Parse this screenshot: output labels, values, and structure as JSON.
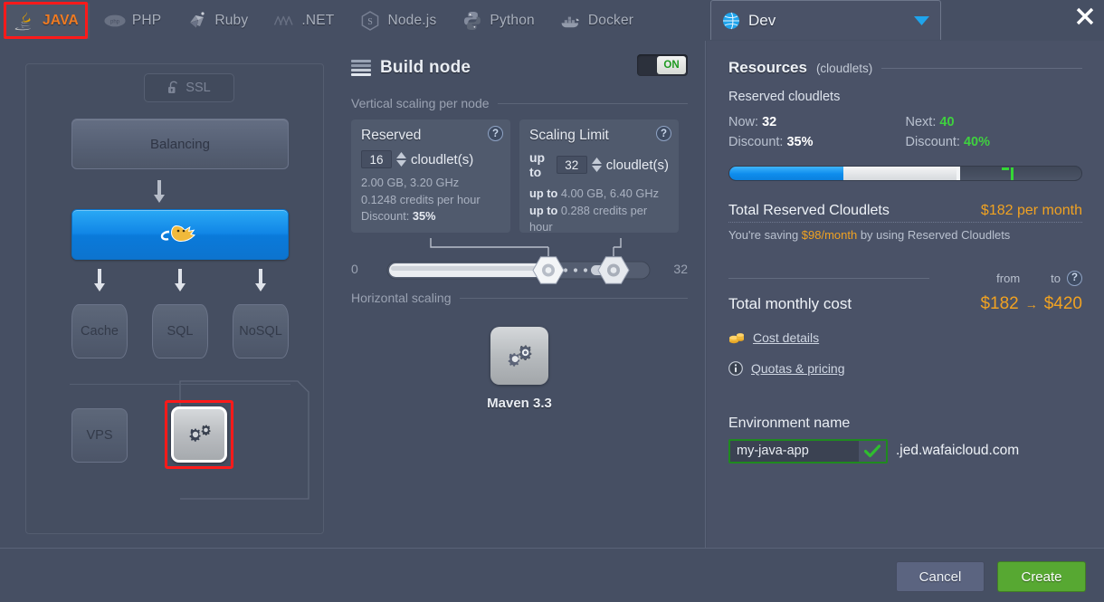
{
  "tabs": [
    {
      "label": "JAVA",
      "icon": "java-icon",
      "active": true
    },
    {
      "label": "PHP",
      "icon": "php-icon",
      "active": false
    },
    {
      "label": "Ruby",
      "icon": "ruby-icon",
      "active": false
    },
    {
      "label": ".NET",
      "icon": "dotnet-icon",
      "active": false
    },
    {
      "label": "Node.js",
      "icon": "nodejs-icon",
      "active": false
    },
    {
      "label": "Python",
      "icon": "python-icon",
      "active": false
    },
    {
      "label": "Docker",
      "icon": "docker-icon",
      "active": false
    }
  ],
  "topology": {
    "ssl_label": "SSL",
    "balancing_label": "Balancing",
    "app_server_icon": "tomcat-icon",
    "databases": [
      {
        "label": "Cache"
      },
      {
        "label": "SQL"
      },
      {
        "label": "NoSQL"
      }
    ],
    "vps_label": "VPS",
    "build_node_icon": "gear-icon"
  },
  "build": {
    "title": "Build node",
    "toggle_label": "ON",
    "vertical_scaling_label": "Vertical scaling per node",
    "horizontal_scaling_label": "Horizontal scaling",
    "reserved": {
      "title": "Reserved",
      "value": "16",
      "unit": "cloudlet(s)",
      "ram_cpu": "2.00 GB, 3.20 GHz",
      "credits": "0.1248 credits per hour",
      "discount_label": "Discount:",
      "discount_value": "35%",
      "help": "?"
    },
    "limit": {
      "title": "Scaling Limit",
      "prefix": "up to",
      "value": "32",
      "unit": "cloudlet(s)",
      "ram_cpu_prefix": "up to",
      "ram_cpu": "4.00 GB, 6.40 GHz",
      "credits_prefix": "up to",
      "credits": "0.288 credits per hour",
      "help": "?"
    },
    "slider": {
      "min_label": "0",
      "max_label": "32",
      "reserved_pos_pct": 50,
      "limit_pos_pct": 84
    },
    "maven": {
      "label": "Maven 3.3",
      "icon": "gear-icon"
    }
  },
  "right": {
    "env_tab": {
      "label": "Dev",
      "icon": "globe-icon",
      "caret": "chevron-down-icon"
    },
    "close": "close-icon",
    "resources": {
      "title": "Resources",
      "subtitle": "(cloudlets)",
      "reserved_label": "Reserved cloudlets",
      "now_label": "Now:",
      "now_value": "32",
      "next_label": "Next:",
      "next_value": "40",
      "discount_now_label": "Discount:",
      "discount_now_value": "35%",
      "discount_next_label": "Discount:",
      "discount_next_value": "40%"
    },
    "total_reserved": {
      "label": "Total Reserved Cloudlets",
      "value": "$182 per month",
      "saving_pre": "You're saving ",
      "saving_amount": "$98/month",
      "saving_post": " by using Reserved Cloudlets"
    },
    "total_cost": {
      "label": "Total monthly cost",
      "from_label": "from",
      "to_label": "to",
      "from_value": "$182",
      "arrow": "→",
      "to_value": "$420",
      "help": "?"
    },
    "links": [
      {
        "label": "Cost details",
        "icon": "coins-icon"
      },
      {
        "label": "Quotas & pricing",
        "icon": "info-icon"
      }
    ],
    "env": {
      "label": "Environment name",
      "value": "my-java-app",
      "placeholder": "Environment name",
      "valid_icon": "check-icon",
      "domain": ".jed.wafaicloud.com"
    }
  },
  "footer": {
    "cancel_label": "Cancel",
    "create_label": "Create"
  },
  "colors": {
    "background": "#464f63",
    "panel": "#4a5267",
    "accent_orange": "#f0a222",
    "accent_blue": "#0e8ded",
    "accent_green": "#35d635",
    "create_green": "#57a832",
    "highlight_red": "#ff1a1a",
    "tab_active_text": "#f07b22"
  }
}
